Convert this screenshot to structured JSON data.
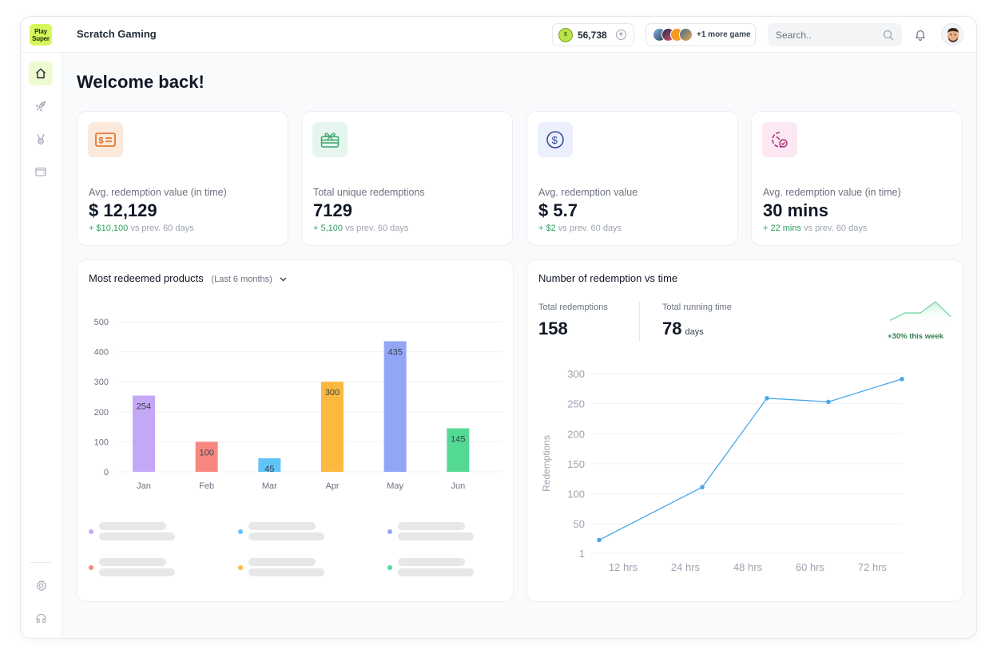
{
  "app": {
    "logo_line1": "Play",
    "logo_line2": "Super",
    "title": "Scratch Gaming"
  },
  "topbar": {
    "coins": "56,738",
    "coin_icon": "coin-icon",
    "add_coins_icon": "plus-circle-icon",
    "games": [
      "game-1",
      "game-2",
      "game-3",
      "game-4"
    ],
    "games_more": "+1 more game",
    "search_placeholder": "Search..",
    "notification_icon": "bell-icon",
    "user_avatar": "avatar"
  },
  "sidebar": {
    "items": [
      {
        "name": "home",
        "icon": "home-icon",
        "active": true
      },
      {
        "name": "rocket",
        "icon": "rocket-icon",
        "active": false
      },
      {
        "name": "rewards",
        "icon": "medal-icon",
        "active": false
      },
      {
        "name": "wallet",
        "icon": "wallet-icon",
        "active": false
      }
    ],
    "bottom_items": [
      {
        "name": "settings",
        "icon": "gear-icon"
      },
      {
        "name": "support",
        "icon": "headset-icon"
      }
    ]
  },
  "page": {
    "welcome": "Welcome back!"
  },
  "stats": [
    {
      "icon": "money-card-icon",
      "label": "Avg. redemption value (in time)",
      "value": "$ 12,129",
      "delta": "+ $10,100",
      "delta_suffix": "vs prev. 60 days",
      "icon_bg": "#fbe9db",
      "icon_color": "#e06a1b"
    },
    {
      "icon": "gift-card-icon",
      "label": "Total unique redemptions",
      "value": "7129",
      "delta": "+ 5,100",
      "delta_suffix": "vs prev. 60 days",
      "icon_bg": "#e6f6ef",
      "icon_color": "#3aa56b"
    },
    {
      "icon": "dollar-circle-icon",
      "label": "Avg. redemption value",
      "value": "$ 5.7",
      "delta": "+ $2",
      "delta_suffix": "vs prev. 60 days",
      "icon_bg": "#eceffd",
      "icon_color": "#2f4a8f"
    },
    {
      "icon": "timer-check-icon",
      "label": "Avg. redemption value (in time)",
      "value": "30 mins",
      "delta": "+ 22 mins",
      "delta_suffix": "vs prev. 60 days",
      "icon_bg": "#fbe8f3",
      "icon_color": "#a3296e"
    }
  ],
  "products_panel": {
    "title": "Most redeemed products",
    "period": "(Last 6 months)",
    "legend_colors": [
      "#c4a8f5",
      "#60c4f7",
      "#91a6f5",
      "#f8887f",
      "#fcb93f",
      "#54d994"
    ]
  },
  "redemption_panel": {
    "title": "Number of redemption vs time",
    "total_redemptions_label": "Total redemptions",
    "total_redemptions": "158",
    "running_time_label": "Total running time",
    "running_time_value": "78",
    "running_time_unit": "days",
    "trend_text": "+30% this week",
    "sparkline": [
      1,
      3,
      3,
      6,
      2
    ]
  },
  "chart_data": [
    {
      "type": "bar",
      "title": "Most redeemed products",
      "categories": [
        "Jan",
        "Feb",
        "Mar",
        "Apr",
        "May",
        "Jun"
      ],
      "values": [
        254,
        100,
        45,
        300,
        435,
        145
      ],
      "colors": [
        "#c4a8f5",
        "#f8887f",
        "#60c4f7",
        "#fcb93f",
        "#91a6f5",
        "#54d994"
      ],
      "yticks": [
        0,
        100,
        200,
        300,
        400,
        500
      ],
      "ylim": [
        0,
        500
      ],
      "xlabel": "",
      "ylabel": "",
      "grid": true,
      "data_labels": true
    },
    {
      "type": "line",
      "title": "Number of redemption vs time",
      "x": [
        "12 hrs",
        "24 hrs",
        "48 hrs",
        "60 hrs",
        "72 hrs"
      ],
      "series": [
        {
          "name": "Redemptions",
          "values": [
            23,
            111,
            259,
            253,
            291
          ],
          "color": "#4aa8ea"
        }
      ],
      "yticks": [
        1,
        50,
        100,
        150,
        200,
        250,
        300
      ],
      "ylim": [
        1,
        300
      ],
      "xlabel": "",
      "ylabel": "Redemptions",
      "grid": true
    }
  ]
}
